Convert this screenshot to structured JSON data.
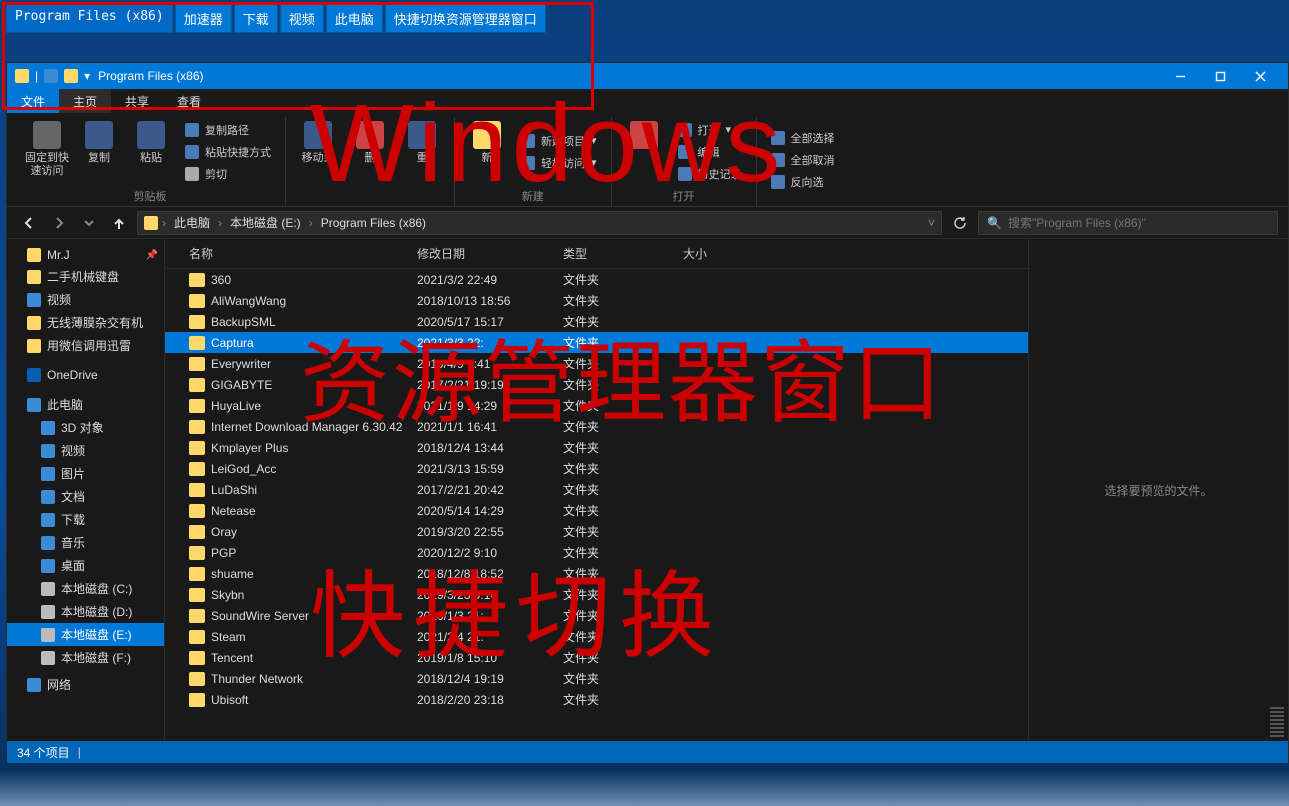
{
  "switcher": {
    "tabs": [
      "Program Files (x86)",
      "加速器",
      "下载",
      "视频",
      "此电脑",
      "快捷切换资源管理器窗口"
    ]
  },
  "window": {
    "title": "Program Files (x86)"
  },
  "menubar": {
    "file": "文件",
    "home": "主页",
    "share": "共享",
    "view": "查看"
  },
  "ribbon": {
    "pin": "固定到快\n速访问",
    "copy": "复制",
    "paste": "粘贴",
    "copypath": "复制路径",
    "pasteshortcut": "粘贴快捷方式",
    "cut": "剪切",
    "group_clipboard": "剪贴板",
    "moveto": "移动到",
    "deleteBtn": "删",
    "rename": "重",
    "newitem": "新建项目",
    "easyaccess": "轻松访问",
    "newfolder": "新",
    "group_new": "新建",
    "open": "打开",
    "edit": "编辑",
    "history": "历史记录",
    "group_open": "打开",
    "selectall": "全部选择",
    "selectnone": "全部取消",
    "invertsel": "反向选",
    "group_select": ""
  },
  "breadcrumb": {
    "pc": "此电脑",
    "drive": "本地磁盘 (E:)",
    "folder": "Program Files (x86)"
  },
  "search": {
    "placeholder": "搜索\"Program Files (x86)\""
  },
  "sidebar": {
    "quick": [
      {
        "label": "Mr.J",
        "icon": "folder",
        "pin": true
      },
      {
        "label": "二手机械键盘",
        "icon": "folder"
      },
      {
        "label": "视频",
        "icon": "blue"
      },
      {
        "label": "无线薄膜杂交有机",
        "icon": "folder"
      },
      {
        "label": "用微信调用迅雷",
        "icon": "folder"
      }
    ],
    "onedrive": "OneDrive",
    "thispc": "此电脑",
    "pc_nodes": [
      {
        "label": "3D 对象",
        "icon": "blue"
      },
      {
        "label": "视频",
        "icon": "blue"
      },
      {
        "label": "图片",
        "icon": "blue"
      },
      {
        "label": "文档",
        "icon": "blue"
      },
      {
        "label": "下载",
        "icon": "blue"
      },
      {
        "label": "音乐",
        "icon": "blue"
      },
      {
        "label": "桌面",
        "icon": "blue"
      },
      {
        "label": "本地磁盘 (C:)",
        "icon": "drive"
      },
      {
        "label": "本地磁盘 (D:)",
        "icon": "drive"
      },
      {
        "label": "本地磁盘 (E:)",
        "icon": "drive",
        "selected": true
      },
      {
        "label": "本地磁盘 (F:)",
        "icon": "drive"
      }
    ],
    "network": "网络"
  },
  "columns": {
    "name": "名称",
    "date": "修改日期",
    "type": "类型",
    "size": "大小"
  },
  "folder_type": "文件夹",
  "files": [
    {
      "name": "360",
      "date": "2021/3/2 22:49"
    },
    {
      "name": "AliWangWang",
      "date": "2018/10/13 18:56"
    },
    {
      "name": "BackupSML",
      "date": "2020/5/17 15:17"
    },
    {
      "name": "Captura",
      "date": "2021/3/3 22:",
      "selected": true
    },
    {
      "name": "Everywriter",
      "date": "2019/4/9 9:41"
    },
    {
      "name": "GIGABYTE",
      "date": "2017/2/21 19:19"
    },
    {
      "name": "HuyaLive",
      "date": "2021/1/9 14:29"
    },
    {
      "name": "Internet Download Manager 6.30.42",
      "date": "2021/1/1 16:41"
    },
    {
      "name": "Kmplayer Plus",
      "date": "2018/12/4 13:44"
    },
    {
      "name": "LeiGod_Acc",
      "date": "2021/3/13 15:59"
    },
    {
      "name": "LuDaShi",
      "date": "2017/2/21 20:42"
    },
    {
      "name": "Netease",
      "date": "2020/5/14 14:29"
    },
    {
      "name": "Oray",
      "date": "2019/3/20 22:55"
    },
    {
      "name": "PGP",
      "date": "2020/12/2 9:10"
    },
    {
      "name": "shuame",
      "date": "2018/12/8 18:52"
    },
    {
      "name": "Skybn",
      "date": "2019/3/23 9:10"
    },
    {
      "name": "SoundWire Server",
      "date": "2020/1/3 21:"
    },
    {
      "name": "Steam",
      "date": "2021/2/4 21:"
    },
    {
      "name": "Tencent",
      "date": "2019/1/8 15:10"
    },
    {
      "name": "Thunder Network",
      "date": "2018/12/4 19:19"
    },
    {
      "name": "Ubisoft",
      "date": "2018/2/20 23:18"
    }
  ],
  "preview": {
    "empty": "选择要预览的文件。"
  },
  "status": {
    "count": "34 个项目"
  },
  "watermark": {
    "l1": "Windows",
    "l2": "资源管理器窗口",
    "l3": "快捷切换"
  }
}
